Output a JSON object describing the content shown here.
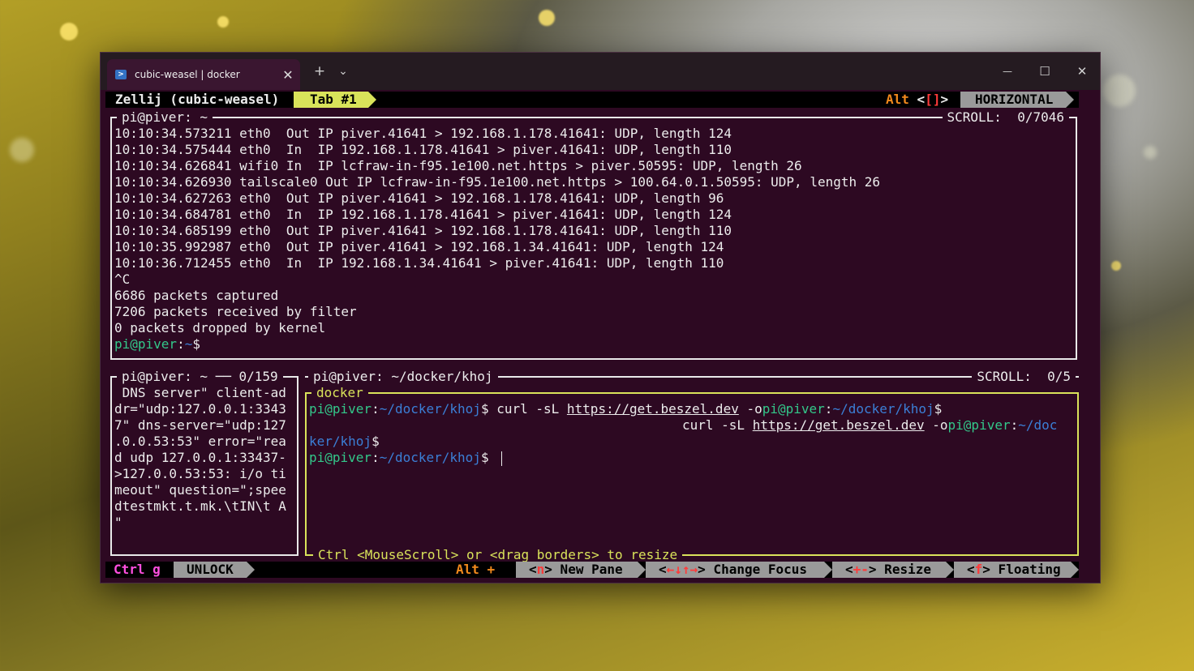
{
  "window": {
    "tab_title": "cubic-weasel | docker",
    "new_tab": "+",
    "tab_dropdown": "⌄",
    "minimize": "—",
    "maximize": "☐",
    "close": "✕",
    "tab_close": "✕"
  },
  "top_bar": {
    "session": "Zellij (cubic-weasel)",
    "tab": "Tab #1",
    "alt_key": "Alt",
    "alt_hint_open": "<",
    "alt_hint_keys": "[]",
    "alt_hint_close": ">",
    "layout": "HORIZONTAL"
  },
  "pane_top": {
    "title": "pi@piver: ~",
    "scroll": "SCROLL:  0/7046",
    "lines": [
      "10:10:34.573211 eth0  Out IP piver.41641 > 192.168.1.178.41641: UDP, length 124",
      "10:10:34.575444 eth0  In  IP 192.168.1.178.41641 > piver.41641: UDP, length 110",
      "10:10:34.626841 wifi0 In  IP lcfraw-in-f95.1e100.net.https > piver.50595: UDP, length 26",
      "10:10:34.626930 tailscale0 Out IP lcfraw-in-f95.1e100.net.https > 100.64.0.1.50595: UDP, length 26",
      "10:10:34.627263 eth0  Out IP piver.41641 > 192.168.1.178.41641: UDP, length 96",
      "10:10:34.684781 eth0  In  IP 192.168.1.178.41641 > piver.41641: UDP, length 124",
      "10:10:34.685199 eth0  Out IP piver.41641 > 192.168.1.178.41641: UDP, length 110",
      "10:10:35.992987 eth0  Out IP piver.41641 > 192.168.1.34.41641: UDP, length 124",
      "10:10:36.712455 eth0  In  IP 192.168.1.34.41641 > piver.41641: UDP, length 110",
      "^C",
      "6686 packets captured",
      "7206 packets received by filter",
      "0 packets dropped by kernel"
    ],
    "prompt_user": "pi@piver",
    "prompt_sep": ":",
    "prompt_path": "~",
    "prompt_end": "$"
  },
  "pane_left": {
    "title": "pi@piver: ~ ── 0/159",
    "lines": [
      " DNS server\" client-ad",
      "dr=\"udp:127.0.0.1:3343",
      "7\" dns-server=\"udp:127",
      ".0.0.53:53\" error=\"rea",
      "d udp 127.0.0.1:33437-",
      ">127.0.0.53:53: i/o ti",
      "meout\" question=\";spee",
      "dtestmkt.t.mk.\\tIN\\t A",
      "\""
    ]
  },
  "pane_right": {
    "title": "pi@piver: ~/docker/khoj",
    "scroll": "SCROLL:  0/5",
    "inner_tab": "docker",
    "prompt_user": "pi@piver",
    "prompt_sep": ":",
    "prompt_path": "~/docker/khoj",
    "prompt_end": "$",
    "cmd_pre": " curl -sL ",
    "cmd_url": "https://get.beszel.dev",
    "cmd_post": " -o",
    "wrap_cmd_pre": "curl -sL ",
    "wrap_cmd_url": "https://get.beszel.dev",
    "wrap_cmd_post": " -o",
    "wrap_path_a": "~/doc",
    "wrap_path_b": "ker/khoj",
    "resize_hint": "Ctrl <MouseScroll> or <drag borders> to resize"
  },
  "bottom_bar": {
    "ctrl": "Ctrl",
    "ctrl_key": "g",
    "unlock": "UNLOCK",
    "alt": "Alt +",
    "items": [
      {
        "open": "<",
        "key": "n",
        "close": ">",
        "label": " New Pane"
      },
      {
        "open": "<",
        "key": "←↓↑→",
        "close": ">",
        "label": " Change Focus"
      },
      {
        "open": "<",
        "key": "+-",
        "close": ">",
        "label": " Resize"
      },
      {
        "open": "<",
        "key": "f",
        "close": ">",
        "label": " Floating"
      }
    ]
  },
  "colors": {
    "terminal_bg": "#2d0922",
    "prompt_user": "#33c88a",
    "prompt_path": "#3b7fd6",
    "accent_green": "#d9e35a",
    "accent_orange": "#f28a1c",
    "key_red": "#ff3b3b",
    "ctrl_magenta": "#ff4fe0"
  }
}
